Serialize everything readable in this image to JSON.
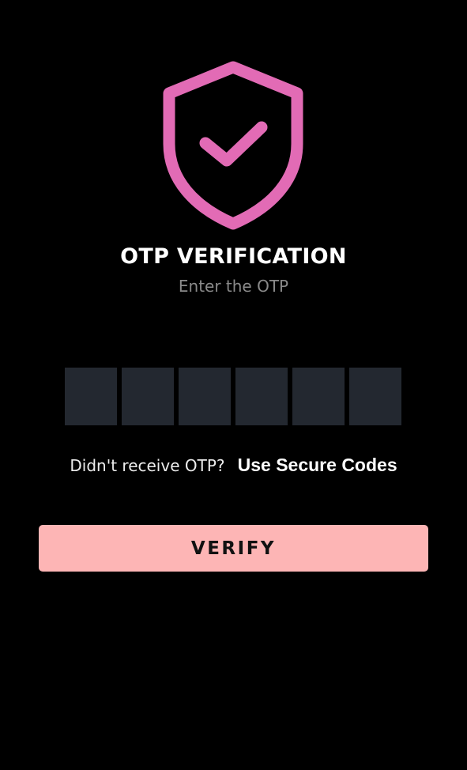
{
  "header": {
    "icon": "shield-check-icon",
    "title": "OTP VERIFICATION",
    "subtitle": "Enter the OTP"
  },
  "otp": {
    "digits": [
      "",
      "",
      "",
      "",
      "",
      ""
    ]
  },
  "resend": {
    "prompt": "Didn't receive OTP?",
    "link_label": "Use Secure Codes"
  },
  "actions": {
    "verify_label": "VERIFY"
  },
  "colors": {
    "background": "#000000",
    "accent": "#e26bb5",
    "button": "#fdb5b5",
    "input_box": "#232830"
  }
}
